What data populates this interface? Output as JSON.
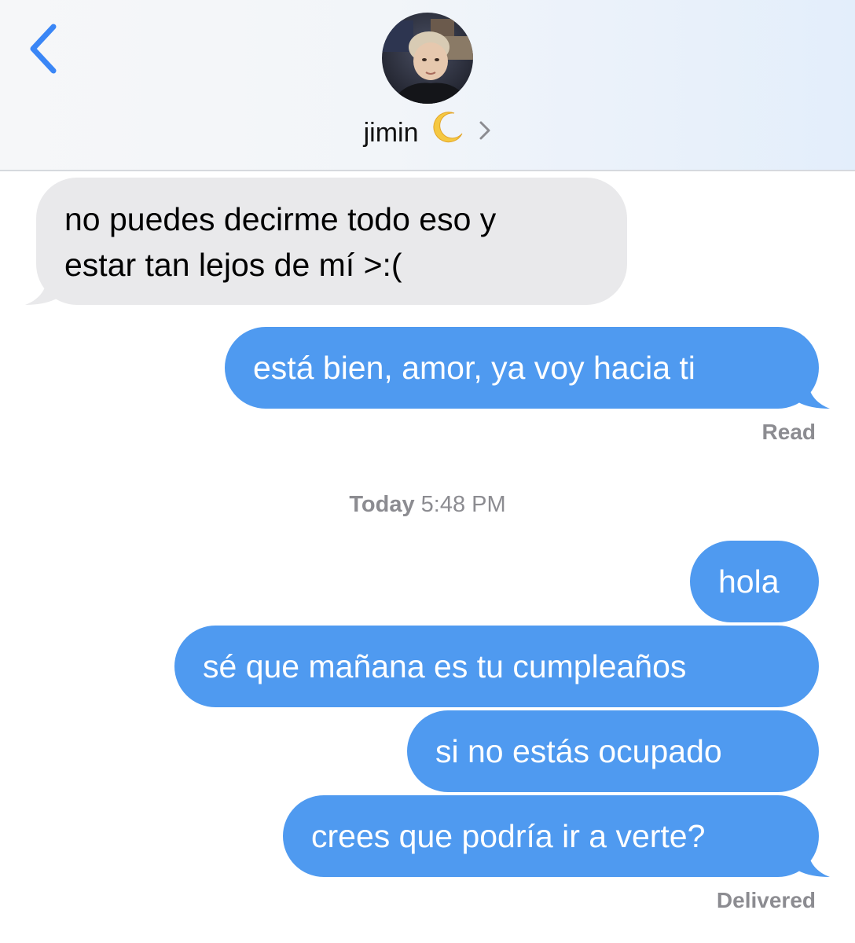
{
  "header": {
    "contact_name": "jimin",
    "moon_icon": "crescent-moon-emoji",
    "back_icon": "chevron-left-icon",
    "details_icon": "chevron-right-icon",
    "accent_color": "#3a86f6",
    "header_gradient_end": "#e3eefb"
  },
  "messages": [
    {
      "direction": "incoming",
      "lines": [
        "no puedes decirme todo eso y",
        "estar tan lejos de mí >:("
      ]
    },
    {
      "direction": "outgoing",
      "text": "está bien, amor, ya voy hacia ti"
    },
    {
      "direction": "outgoing",
      "text": "hola"
    },
    {
      "direction": "outgoing",
      "text": "sé que mañana es tu cumpleaños"
    },
    {
      "direction": "outgoing",
      "text": "si no estás ocupado"
    },
    {
      "direction": "outgoing",
      "text": "crees que podría ir a verte?"
    }
  ],
  "status": {
    "read": "Read",
    "delivered": "Delivered"
  },
  "timestamp": {
    "day": "Today",
    "time": "5:48 PM"
  },
  "colors": {
    "outgoing_bubble": "#4f9af0",
    "incoming_bubble": "#e9e9eb",
    "status_text": "#8c8c91"
  }
}
